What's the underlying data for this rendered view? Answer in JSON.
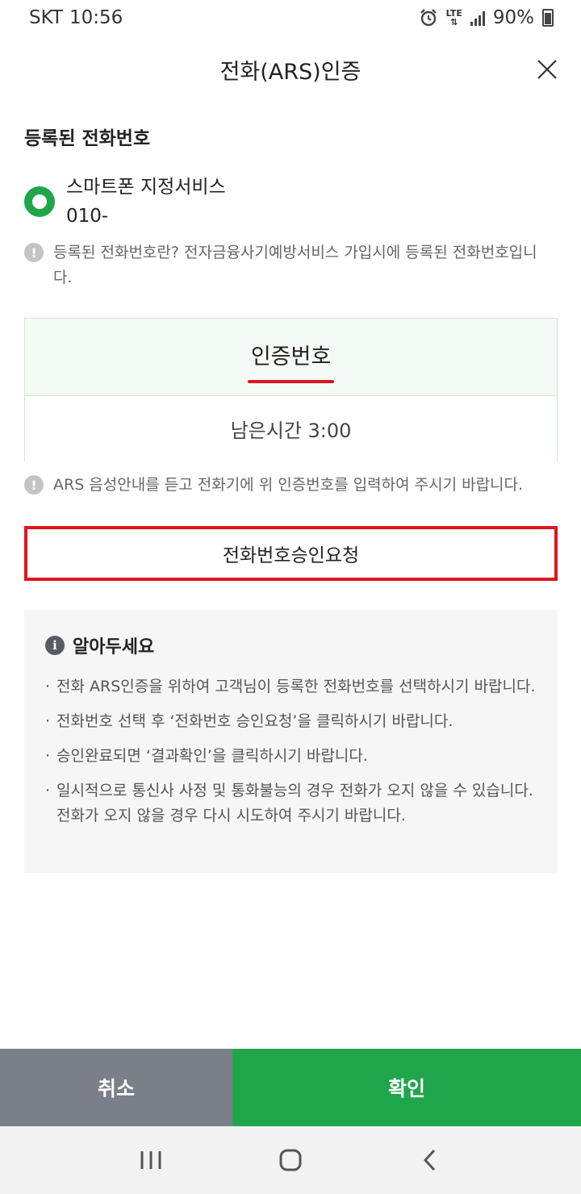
{
  "status_bar": {
    "carrier": "SKT",
    "time": "10:56",
    "network": "LTE",
    "battery": "90%",
    "icons": [
      "alarm-icon",
      "lte-icon",
      "signal-icon",
      "battery-icon"
    ]
  },
  "header": {
    "title": "전화(ARS)인증",
    "close_icon": "close-icon"
  },
  "registered_phone": {
    "section_title": "등록된 전화번호",
    "option_name": "스마트폰 지정서비스",
    "option_number": "010-",
    "selected": true,
    "notice": "등록된 전화번호란? 전자금융사기예방서비스 가입시에 등록된 전화번호입니다."
  },
  "auth": {
    "code_label": "인증번호",
    "remaining_time": "남은시간 3:00",
    "notice": "ARS 음성안내를 듣고 전화기에 위 인증번호를 입력하여 주시기 바랍니다."
  },
  "request_button": {
    "label": "전화번호승인요청"
  },
  "info": {
    "title": "알아두세요",
    "items": [
      "전화 ARS인증을 위하여 고객님이 등록한 전화번호를 선택하시기 바랍니다.",
      "전화번호 선택 후 ‘전화번호 승인요청’을 클릭하시기 바랍니다.",
      "승인완료되면 ‘결과확인’을 클릭하시기 바랍니다.",
      "일시적으로 통신사 사정 및 통화불능의 경우 전화가 오지 않을 수 있습니다. 전화가 오지 않을 경우 다시 시도하여 주시기 바랍니다."
    ]
  },
  "footer": {
    "cancel_label": "취소",
    "confirm_label": "확인"
  },
  "colors": {
    "primary_green": "#1fa64a",
    "cancel_gray": "#7a7f88",
    "highlight_red": "#e0141e"
  }
}
